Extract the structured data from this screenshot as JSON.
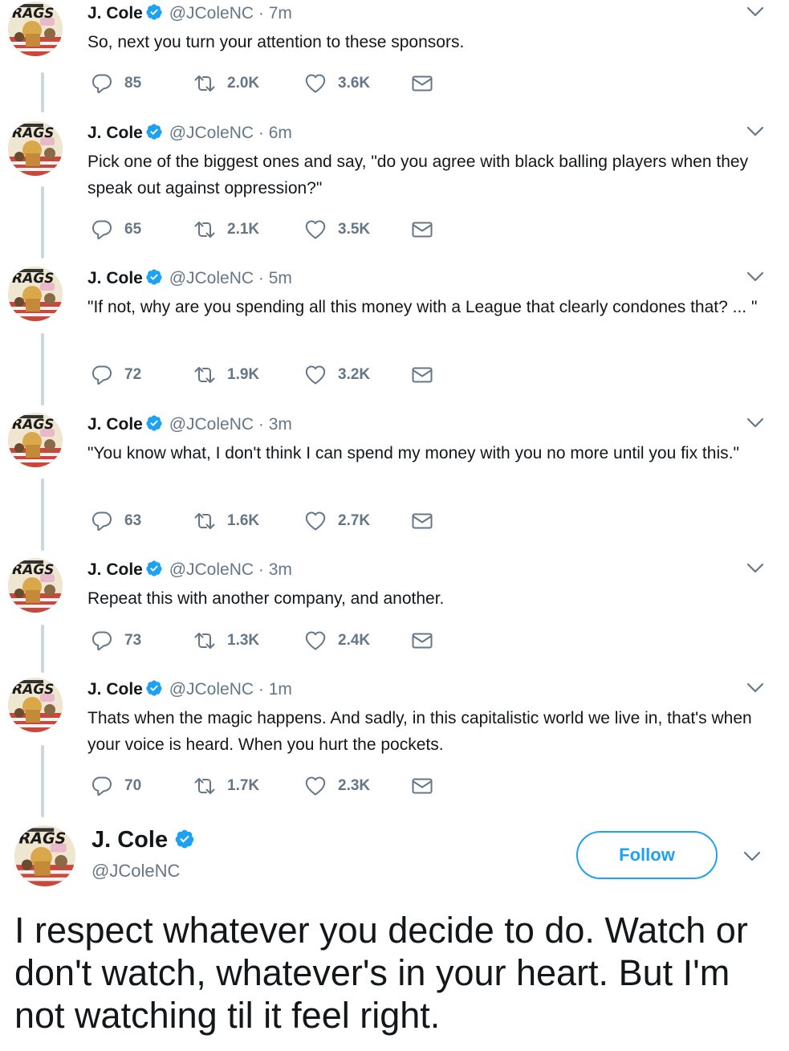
{
  "author": {
    "name": "J. Cole",
    "handle": "@JColeNC"
  },
  "colors": {
    "accent": "#1da1f2",
    "muted": "#657786",
    "text": "#14171a",
    "thread_line": "#ccd6dd"
  },
  "tweets": [
    {
      "name": "J. Cole",
      "handle": "@JColeNC",
      "dot": "·",
      "time": "7m",
      "text": "So, next you turn your attention to these sponsors.",
      "replies": "85",
      "retweets": "2.0K",
      "likes": "3.6K"
    },
    {
      "name": "J. Cole",
      "handle": "@JColeNC",
      "dot": "·",
      "time": "6m",
      "text": "Pick one of the biggest ones and say, \"do you agree with black balling players when they speak out against oppression?\"",
      "replies": "65",
      "retweets": "2.1K",
      "likes": "3.5K"
    },
    {
      "name": "J. Cole",
      "handle": "@JColeNC",
      "dot": "·",
      "time": "5m",
      "text": "\"If not, why are you spending all this money with a League that clearly condones that? ... \"",
      "replies": "72",
      "retweets": "1.9K",
      "likes": "3.2K"
    },
    {
      "name": "J. Cole",
      "handle": "@JColeNC",
      "dot": "·",
      "time": "3m",
      "text": "\"You know what, I don't think I can spend my money with you no more until you fix this.\"",
      "replies": "63",
      "retweets": "1.6K",
      "likes": "2.7K"
    },
    {
      "name": "J. Cole",
      "handle": "@JColeNC",
      "dot": "·",
      "time": "3m",
      "text": "Repeat this with another company, and another.",
      "replies": "73",
      "retweets": "1.3K",
      "likes": "2.4K"
    },
    {
      "name": "J. Cole",
      "handle": "@JColeNC",
      "dot": "·",
      "time": "1m",
      "text": "Thats when the magic happens. And sadly, in this capitalistic world we live in, that's when your voice is heard. When you hurt the pockets.",
      "replies": "70",
      "retweets": "1.7K",
      "likes": "2.3K"
    }
  ],
  "profile": {
    "name": "J. Cole",
    "handle": "@JColeNC",
    "follow_label": "Follow"
  },
  "final_tweet": {
    "text": "I respect whatever you decide to do. Watch or don't watch, whatever's in your heart. But I'm not watching til it feel right."
  },
  "icons": [
    "reply-icon",
    "retweet-icon",
    "like-icon",
    "direct-message-icon",
    "verified-badge-icon",
    "chevron-down-icon",
    "avatar-image"
  ]
}
